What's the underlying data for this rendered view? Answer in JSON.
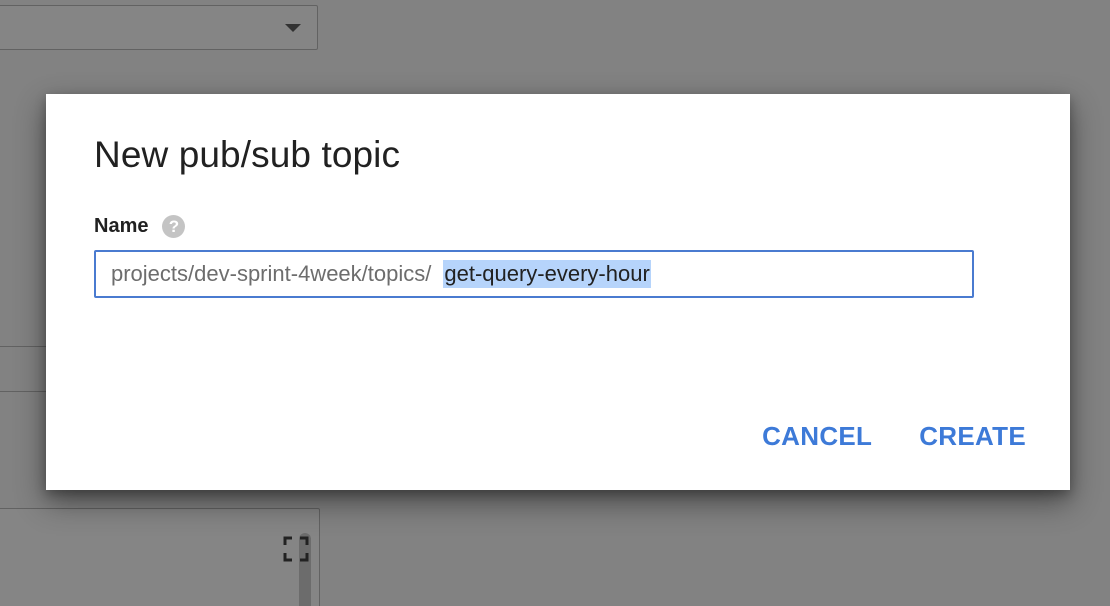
{
  "dialog": {
    "title": "New pub/sub topic",
    "name_label": "Name",
    "help_icon_glyph": "?",
    "input_prefix": "projects/dev-sprint-4week/topics/",
    "input_value": "get-query-every-hour",
    "cancel_label": "CANCEL",
    "create_label": "CREATE"
  },
  "icons": {
    "help": "help-icon",
    "dropdown": "caret-down-icon",
    "fullscreen": "fullscreen-icon"
  },
  "colors": {
    "accent": "#3d7ad8",
    "input_border": "#4a7bd0",
    "selection": "#b6d4fb"
  }
}
